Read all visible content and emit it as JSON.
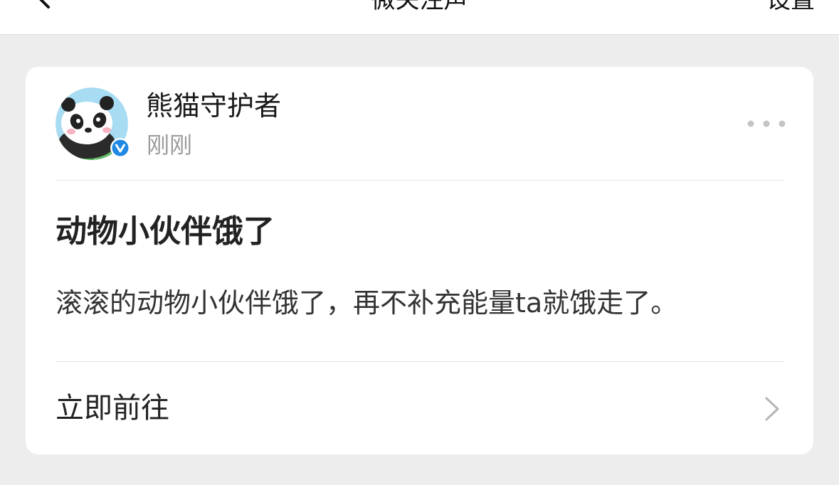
{
  "nav": {
    "title": "微关注声",
    "action": "设置",
    "back_icon": "chevron-left-icon"
  },
  "card": {
    "author": {
      "name": "熊猫守护者",
      "time": "刚刚",
      "avatar_icon": "panda-avatar",
      "verified_icon": "verified-v-icon",
      "verified_color": "#1e88e5"
    },
    "more_icon": "more-dots-icon",
    "title": "动物小伙伴饿了",
    "body": "滚滚的动物小伙伴饿了，再不补充能量ta就饿走了。",
    "link": {
      "label": "立即前往",
      "icon": "chevron-right-icon"
    }
  },
  "colors": {
    "background": "#ededed",
    "card": "#ffffff",
    "secondary_text": "#9b9b9b",
    "divider": "#e5e5e5"
  }
}
